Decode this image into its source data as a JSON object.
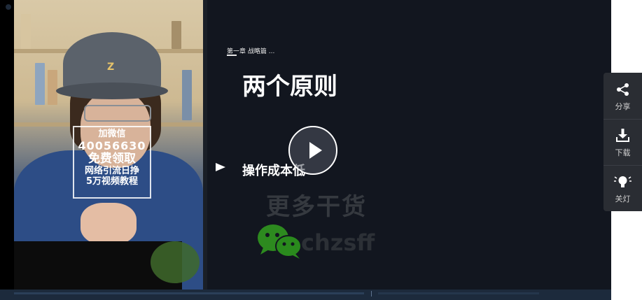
{
  "video": {
    "overlay_line1": "加微信",
    "overlay_line2": "40056630",
    "overlay_line3": "免费领取",
    "overlay_line4": "网络引流日挣",
    "overlay_line5": "5万视频教程",
    "cap_logo": "Z"
  },
  "slide": {
    "chapter": "第一章 战略篇 ...",
    "title": "两个原则",
    "bullet": "操作成本低",
    "promo_text": "更多干货",
    "wechat_id": "chzsff"
  },
  "player": {
    "play_icon": "play-icon",
    "progress_fraction": 0.0
  },
  "side_panel": {
    "items": [
      {
        "label": "分享",
        "icon": "share-icon"
      },
      {
        "label": "下载",
        "icon": "download-icon"
      },
      {
        "label": "关灯",
        "icon": "lightbulb-icon"
      }
    ]
  },
  "colors": {
    "slide_bg": "#12161f",
    "panel_bg": "#2a2d33",
    "wechat_green": "#2d8a1f"
  }
}
